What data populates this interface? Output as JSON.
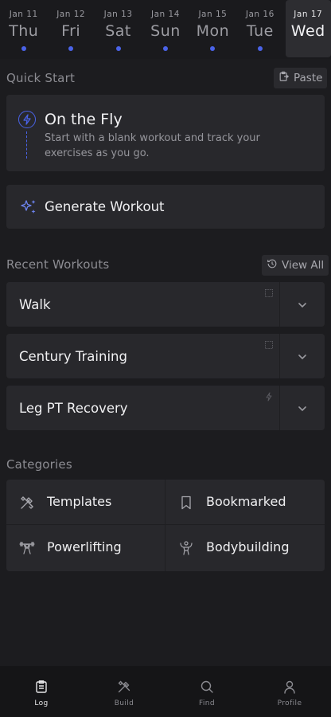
{
  "dates": [
    {
      "month_day": "Jan 11",
      "weekday": "Thu",
      "has_workout": true,
      "active": false
    },
    {
      "month_day": "Jan 12",
      "weekday": "Fri",
      "has_workout": true,
      "active": false
    },
    {
      "month_day": "Jan 13",
      "weekday": "Sat",
      "has_workout": true,
      "active": false
    },
    {
      "month_day": "Jan 14",
      "weekday": "Sun",
      "has_workout": true,
      "active": false
    },
    {
      "month_day": "Jan 15",
      "weekday": "Mon",
      "has_workout": true,
      "active": false
    },
    {
      "month_day": "Jan 16",
      "weekday": "Tue",
      "has_workout": true,
      "active": false
    },
    {
      "month_day": "Jan 17",
      "weekday": "Wed",
      "has_workout": false,
      "active": true
    }
  ],
  "quick_start": {
    "title": "Quick Start",
    "paste_label": "Paste",
    "on_the_fly": {
      "title": "On the Fly",
      "description": "Start with a blank workout and track your exercises as you go."
    },
    "generate_label": "Generate Workout"
  },
  "recent": {
    "title": "Recent Workouts",
    "view_all_label": "View All",
    "items": [
      {
        "label": "Walk",
        "mark_icon": "template-icon"
      },
      {
        "label": "Century Training",
        "mark_icon": "template-icon"
      },
      {
        "label": "Leg PT Recovery",
        "mark_icon": "bolt-icon"
      }
    ]
  },
  "categories": {
    "title": "Categories",
    "items": [
      {
        "label": "Templates",
        "icon": "tools-icon"
      },
      {
        "label": "Bookmarked",
        "icon": "bookmark-icon"
      },
      {
        "label": "Powerlifting",
        "icon": "powerlifter-icon"
      },
      {
        "label": "Bodybuilding",
        "icon": "bodybuilder-icon"
      }
    ]
  },
  "nav": [
    {
      "label": "Log",
      "icon": "clipboard-icon",
      "active": true
    },
    {
      "label": "Build",
      "icon": "tools-icon",
      "active": false
    },
    {
      "label": "Find",
      "icon": "search-icon",
      "active": false
    },
    {
      "label": "Profile",
      "icon": "person-icon",
      "active": false
    }
  ],
  "colors": {
    "accent": "#4a63e8",
    "background": "#1c1c1f",
    "card": "#28282c"
  }
}
